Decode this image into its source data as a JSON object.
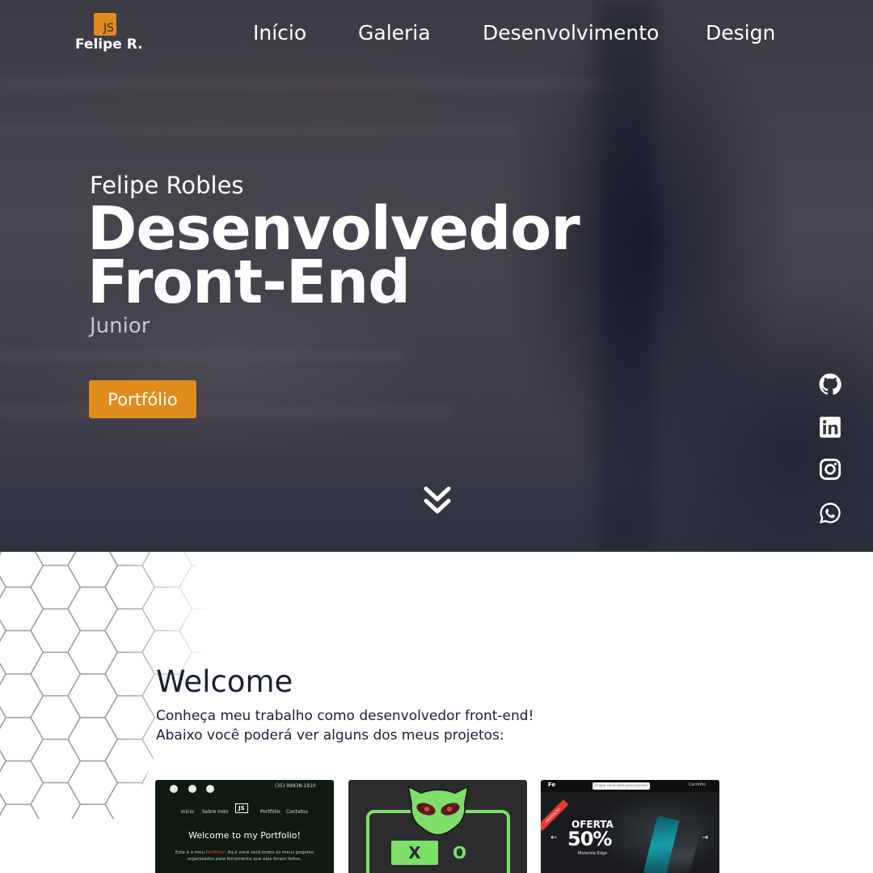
{
  "brand": {
    "badge": "JS",
    "name": "Felipe R.",
    "accent": "#e08c1c"
  },
  "nav": {
    "items": [
      "Início",
      "Galeria",
      "Desenvolvimento",
      "Design"
    ]
  },
  "hero": {
    "name": "Felipe Robles",
    "title_line1": "Desenvolvedor",
    "title_line2": "Front-End",
    "level": "Junior",
    "button": "Portfólio",
    "scroll_icon": "double-chevron-down-icon"
  },
  "social": [
    "github-icon",
    "linkedin-icon",
    "instagram-icon",
    "whatsapp-icon"
  ],
  "welcome": {
    "title": "Welcome",
    "line1": "Conheça meu trabalho como desenvolvedor front-end!",
    "line2": "Abaixo você poderá ver alguns dos meus projetos:"
  },
  "projects": {
    "portfolio": {
      "phone": "(35) 99838-1910",
      "menu": [
        "Início",
        "Sobre mim",
        "Portfólio",
        "Contatos"
      ],
      "logo": "JS",
      "headline": "Welcome to my Portfolio!",
      "text_a": "Este é o meu ",
      "text_hl": "Portfólio!",
      "text_b": " Aqui você verá todos os meus projetos",
      "text_c": "organizados pela ferramenta que eles foram feitos."
    },
    "game": {
      "x": "X",
      "o": "O",
      "color": "#7ee06a"
    },
    "store": {
      "brand": "Fe",
      "search": "O que você está procurando?",
      "cart": "Carrinho",
      "ribbon": "PROMOÇÃO",
      "offer_line1": "OFERTA",
      "offer_line2": "50%",
      "model": "Motorola Edge"
    }
  }
}
